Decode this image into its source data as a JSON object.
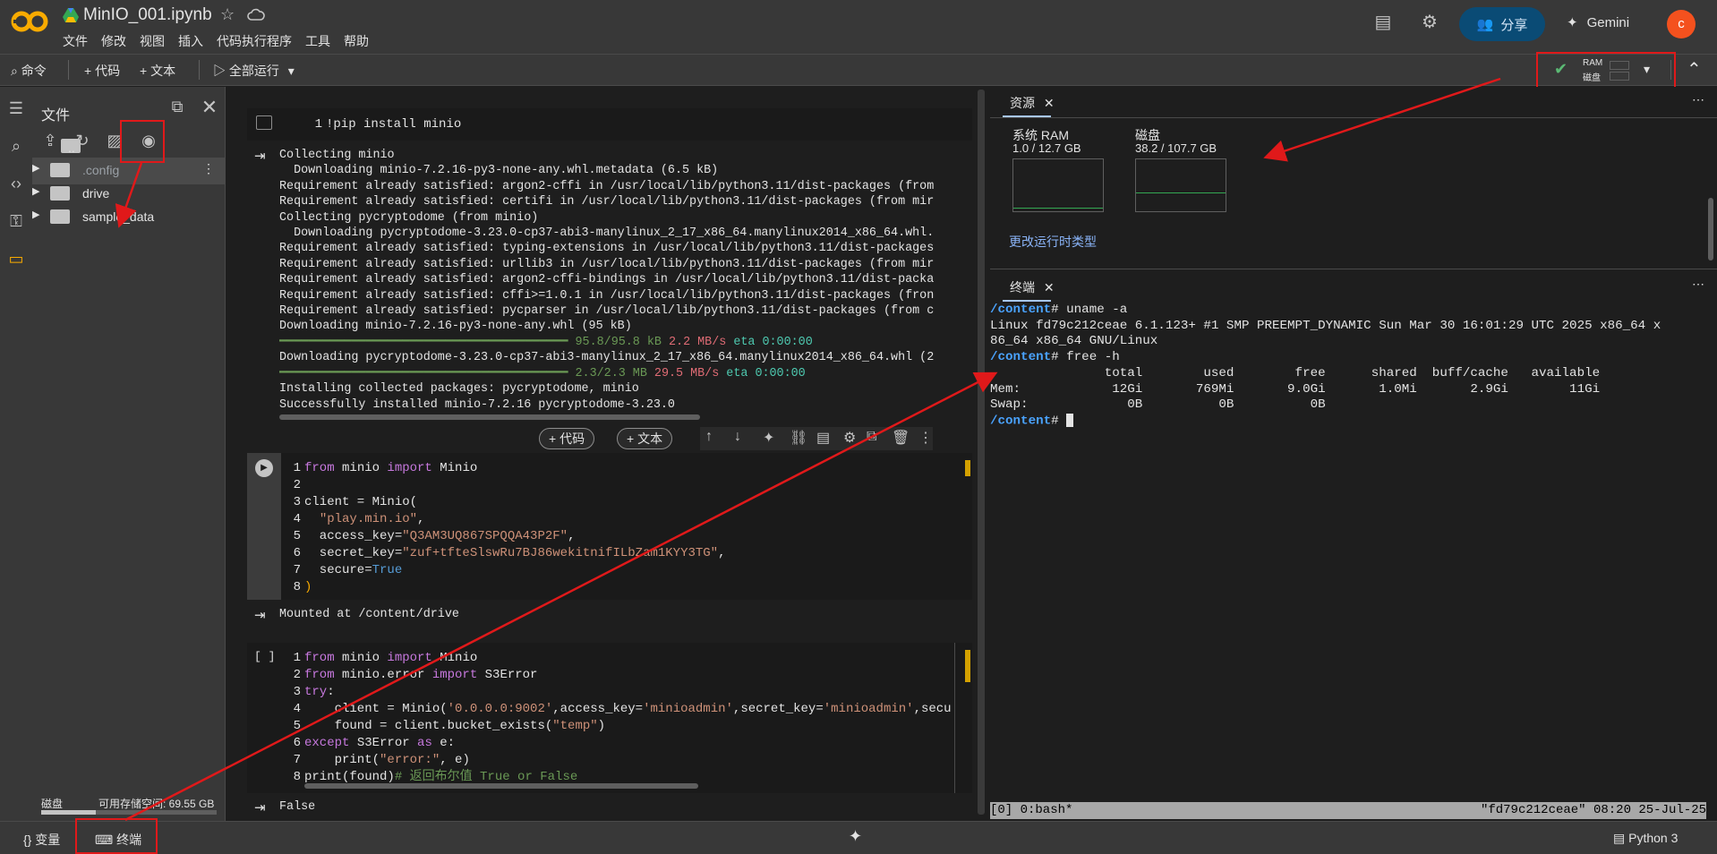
{
  "header": {
    "title": "MinIO_001.ipynb",
    "menu": [
      "文件",
      "修改",
      "视图",
      "插入",
      "代码执行程序",
      "工具",
      "帮助"
    ],
    "share_label": "分享",
    "gemini_label": "Gemini",
    "avatar_letter": "c"
  },
  "toolbar": {
    "command_label": "命令",
    "add_code_label": "+ 代码",
    "add_text_label": "+ 文本",
    "run_all_label": "全部运行",
    "ram_label": "RAM",
    "disk_label": "磁盘"
  },
  "files": {
    "title": "文件",
    "items": [
      "..",
      ".config",
      "drive",
      "sample_data"
    ],
    "disk_label": "磁盘",
    "disk_free": "可用存储空间: 69.55 GB",
    "disk_usage_fraction": 0.31
  },
  "cells": {
    "cell1": {
      "code": "!pip install minio",
      "output": [
        "Collecting minio",
        "  Downloading minio-7.2.16-py3-none-any.whl.metadata (6.5 kB)",
        "Requirement already satisfied: argon2-cffi in /usr/local/lib/python3.11/dist-packages (from",
        "Requirement already satisfied: certifi in /usr/local/lib/python3.11/dist-packages (from mir",
        "Collecting pycryptodome (from minio)",
        "  Downloading pycryptodome-3.23.0-cp37-abi3-manylinux_2_17_x86_64.manylinux2014_x86_64.whl.",
        "Requirement already satisfied: typing-extensions in /usr/local/lib/python3.11/dist-packages",
        "Requirement already satisfied: urllib3 in /usr/local/lib/python3.11/dist-packages (from mir",
        "Requirement already satisfied: argon2-cffi-bindings in /usr/local/lib/python3.11/dist-packa",
        "Requirement already satisfied: cffi>=1.0.1 in /usr/local/lib/python3.11/dist-packages (fron",
        "Requirement already satisfied: pycparser in /usr/local/lib/python3.11/dist-packages (from c",
        "Downloading minio-7.2.16-py3-none-any.whl (95 kB)"
      ],
      "progress1": "95.8/95.8 kB",
      "speed1": "2.2 MB/s",
      "eta1": "eta 0:00:00",
      "download2": "Downloading pycryptodome-3.23.0-cp37-abi3-manylinux_2_17_x86_64.manylinux2014_x86_64.whl (2",
      "progress2": "2.3/2.3 MB",
      "speed2": "29.5 MB/s",
      "eta2": "eta 0:00:00",
      "installing": "Installing collected packages: pycryptodome, minio",
      "success": "Successfully installed minio-7.2.16 pycryptodome-3.23.0"
    },
    "add_code": "代码",
    "add_text": "文本",
    "cell2_output": "Mounted at /content/drive",
    "cell3_prompt": "[ ]",
    "cell3_output": "False"
  },
  "resources": {
    "tab_label": "资源",
    "ram_title": "系统 RAM",
    "ram_value": "1.0 / 12.7 GB",
    "disk_title": "磁盘",
    "disk_value": "38.2 / 107.7 GB",
    "change_runtime": "更改运行时类型"
  },
  "terminal": {
    "tab_label": "终端",
    "lines": [
      {
        "prompt": "/content",
        "cmd": "# uname -a"
      },
      {
        "text": "Linux fd79c212ceae 6.1.123+ #1 SMP PREEMPT_DYNAMIC Sun Mar 30 16:01:29 UTC 2025 x86_64 x"
      },
      {
        "text": "86_64 x86_64 GNU/Linux"
      },
      {
        "prompt": "/content",
        "cmd": "# free -h"
      },
      {
        "text": "               total        used        free      shared  buff/cache   available"
      },
      {
        "text": "Mem:            12Gi       769Mi       9.0Gi       1.0Mi       2.9Gi        11Gi"
      },
      {
        "text": "Swap:             0B          0B          0B"
      },
      {
        "prompt": "/content",
        "cmd": "# "
      }
    ],
    "status_left": "[0] 0:bash*",
    "status_right": "\"fd79c212ceae\" 08:20 25-Jul-25"
  },
  "bottom": {
    "variables_label": "变量",
    "terminal_label": "终端",
    "kernel_label": "Python 3"
  }
}
